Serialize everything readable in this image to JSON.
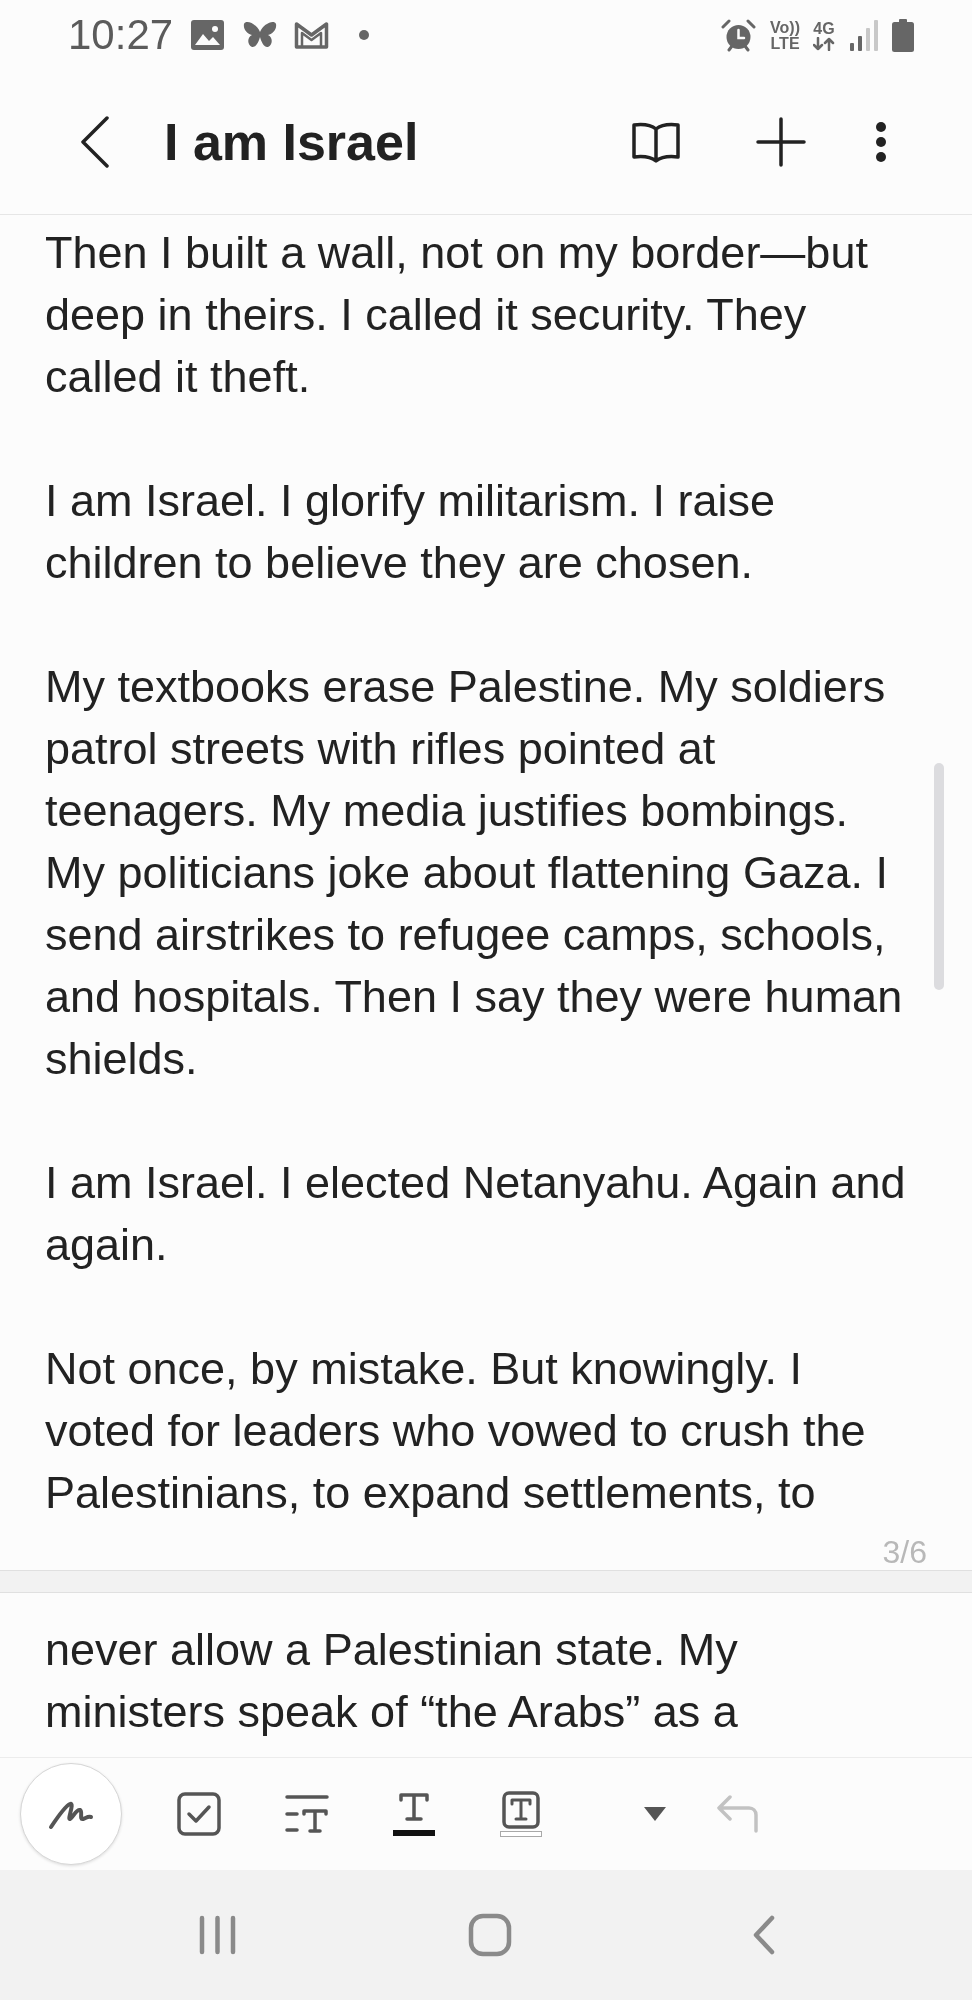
{
  "status_bar": {
    "time": "10:27",
    "volte_top": "Vo))",
    "volte_bottom": "LTE",
    "network": "4G"
  },
  "header": {
    "title": "I am Israel"
  },
  "pages": [
    {
      "paragraphs": [
        "Then I built a wall, not on my border—but deep in theirs. I called it security. They called it theft.",
        "I am Israel. I glorify militarism. I raise children to believe they are chosen.",
        "My textbooks erase Palestine. My soldiers patrol streets with rifles pointed at teenagers. My media justifies bombings. My politicians joke about flattening Gaza. I send airstrikes to refugee camps, schools, and hospitals. Then I say they were human shields.",
        "I am Israel. I elected Netanyahu. Again and again.",
        "Not once, by mistake. But knowingly. I voted for leaders who vowed to crush the Palestinians, to expand settlements, to"
      ],
      "page_number": "3/6"
    },
    {
      "paragraphs": [
        "never allow a Palestinian state. My ministers speak of “the Arabs” as a"
      ]
    }
  ],
  "toolbar": {
    "items": [
      {
        "kind": "pen",
        "disabled": false
      },
      {
        "kind": "checkbox",
        "disabled": false
      },
      {
        "kind": "text_style",
        "disabled": false
      },
      {
        "kind": "font_color",
        "disabled": false,
        "color": "#111111"
      },
      {
        "kind": "highlight",
        "disabled": false,
        "color": "#ffffff"
      },
      {
        "kind": "more",
        "disabled": false
      },
      {
        "kind": "undo",
        "disabled": true
      }
    ]
  }
}
